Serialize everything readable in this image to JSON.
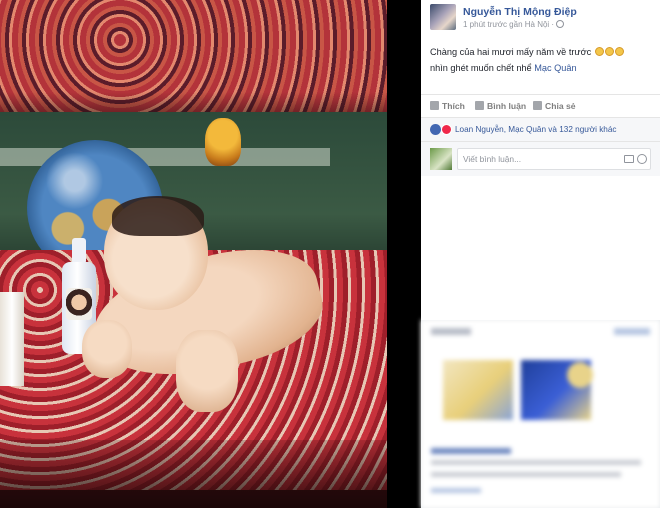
{
  "post": {
    "author": "Nguyễn Thị Mộng Điệp",
    "time_location": "1 phút trước gần Hà Nội ·",
    "text_line1": "Chàng của hai mươi mấy năm về trước",
    "text_line2_prefix": "nhìn ghét muốn chết nhể ",
    "mention": "Mạc Quân"
  },
  "actions": {
    "like": "Thích",
    "comment": "Bình luận",
    "share": "Chia sẻ"
  },
  "reactions": {
    "summary": "Loan Nguyễn, Mạc Quân và 132 người khác"
  },
  "comment_box": {
    "placeholder": "Viết bình luận..."
  },
  "icons": {
    "globe": "globe-icon",
    "camera": "camera-icon",
    "emoji": "emoji-icon",
    "like": "thumbs-up-icon",
    "comment": "comment-icon",
    "share": "share-icon"
  },
  "colors": {
    "link": "#365899",
    "like_reaction": "#4267b2",
    "love_reaction": "#f0284a"
  }
}
